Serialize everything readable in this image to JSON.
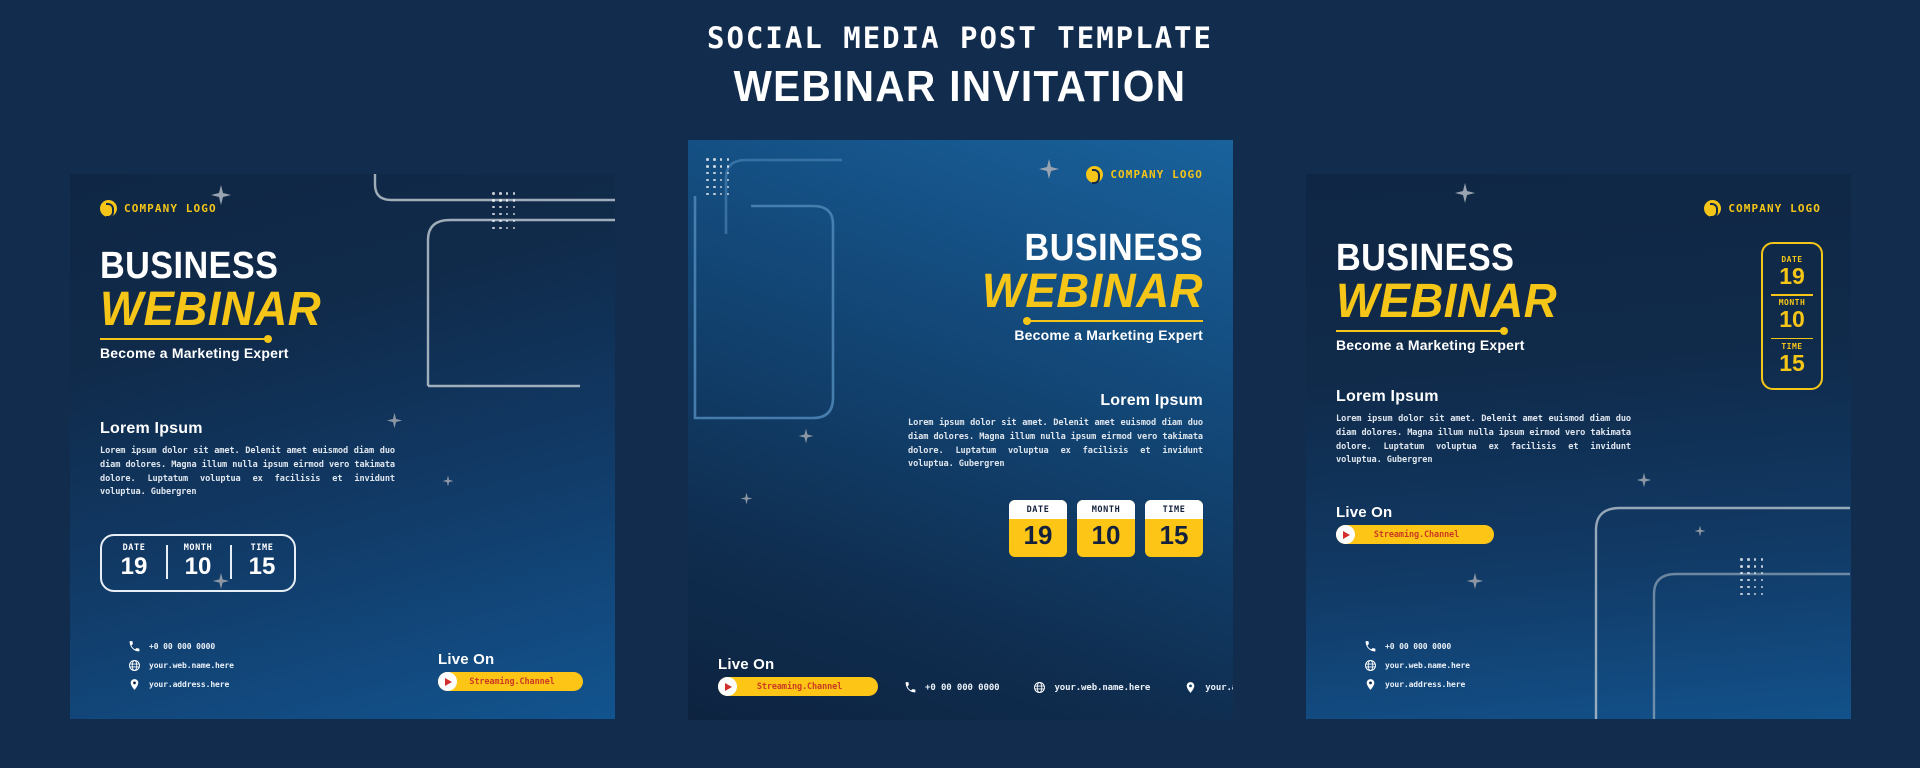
{
  "header": {
    "kicker": "SOCIAL MEDIA POST TEMPLATE",
    "title": "WEBINAR INVITATION"
  },
  "theme": {
    "page_bg": "#122c4d",
    "accent_yellow": "#f5c518",
    "accent_red": "#cc3a24",
    "text_white": "#ffffff",
    "dark_navy": "#14213d"
  },
  "shared": {
    "logo_text": "COMPANY LOGO",
    "kicker_business": "BUSINESS",
    "headline_webinar": "WEBINAR",
    "tagline": "Become a Marketing Expert",
    "body_heading": "Lorem Ipsum",
    "body_copy": "Lorem ipsum dolor sit amet. Delenit amet euismod diam duo diam dolores. Magna illum nulla ipsum eirmod vero takimata dolore. Luptatum voluptua ex facilisis et invidunt voluptua. Gubergren",
    "live_on_label": "Live On",
    "streaming_channel": "Streaming.Channel",
    "contact": {
      "phone": "+0 00 000 0000",
      "website": "your.web.name.here",
      "address": "your.address.here"
    },
    "date_fields": [
      {
        "label": "DATE",
        "value": "19"
      },
      {
        "label": "MONTH",
        "value": "10"
      },
      {
        "label": "TIME",
        "value": "15"
      }
    ]
  },
  "posts": [
    {
      "id": "post-1",
      "variant": "outlined-date-bar",
      "align": "left"
    },
    {
      "id": "post-2",
      "variant": "yellow-date-cards",
      "align": "right"
    },
    {
      "id": "post-3",
      "variant": "vertical-date-rail",
      "align": "left"
    }
  ]
}
